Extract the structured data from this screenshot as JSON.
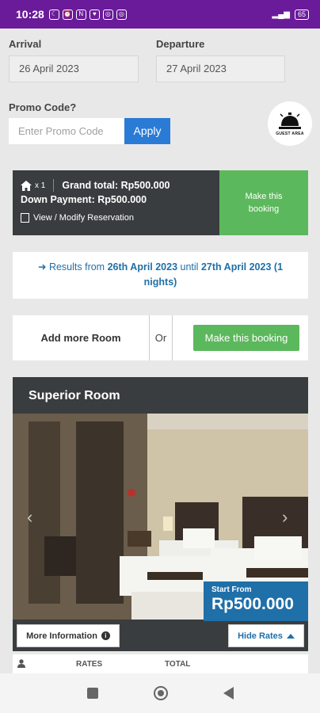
{
  "status": {
    "time": "10:28",
    "battery": "65"
  },
  "form": {
    "arrival_label": "Arrival",
    "arrival_value": "26 April 2023",
    "departure_label": "Departure",
    "departure_value": "27 April 2023",
    "promo_label": "Promo Code?",
    "promo_placeholder": "Enter Promo Code",
    "apply_label": "Apply",
    "guest_area_label": "GUEST AREA"
  },
  "summary": {
    "room_count": "x 1",
    "grand_total": "Grand total: Rp500.000",
    "down_payment": "Down Payment: Rp500.000",
    "view_modify": "View / Modify Reservation",
    "make_booking": "Make this booking"
  },
  "results": {
    "prefix": "Results from",
    "from_date": "26th April 2023",
    "until_word": "until",
    "until_date": "27th April 2023",
    "nights": "(1 nights)"
  },
  "actions": {
    "add_room": "Add more Room",
    "or": "Or",
    "make_booking": "Make this booking"
  },
  "room": {
    "title": "Superior Room",
    "start_from": "Start From",
    "price": "Rp500.000",
    "more_info": "More Information",
    "hide_rates": "Hide Rates"
  },
  "rates_table": {
    "col_rates": "RATES",
    "col_total": "TOTAL"
  }
}
